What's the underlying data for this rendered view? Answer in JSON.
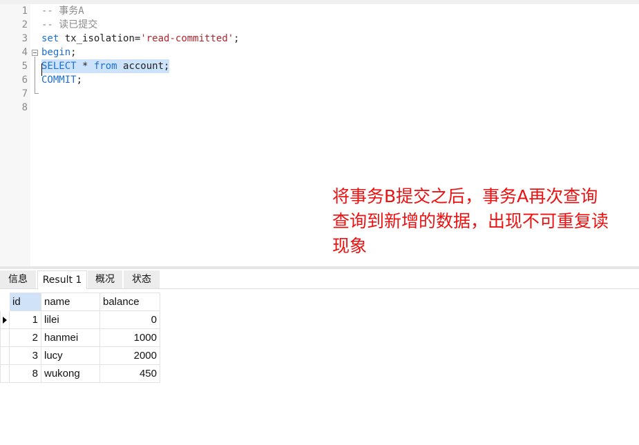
{
  "editor": {
    "line_numbers": [
      "1",
      "2",
      "3",
      "4",
      "5",
      "6",
      "7",
      "8"
    ],
    "lines": {
      "l1": {
        "comment": "-- 事务A"
      },
      "l2": {
        "comment": "-- 读已提交"
      },
      "l3": {
        "kw": "set",
        "plain": " tx_isolation=",
        "str": "'read-committed'",
        "end": ";"
      },
      "l4": {
        "kw": "begin",
        "end": ";"
      },
      "l5": {
        "kw1": "SELECT",
        "op": " * ",
        "kw2": "from",
        "plain": " account;"
      },
      "l6": {
        "kw": "COMMIT",
        "end": ";"
      }
    }
  },
  "annotation": {
    "line1": "将事务B提交之后，事务A再次查询",
    "line2": "查询到新增的数据，出现不可重复读",
    "line3": "现象"
  },
  "result_tabs": [
    {
      "label": "信息"
    },
    {
      "label": "Result 1"
    },
    {
      "label": "概况"
    },
    {
      "label": "状态"
    }
  ],
  "active_tab": "Result 1",
  "result_grid": {
    "columns": [
      "id",
      "name",
      "balance"
    ],
    "rows": [
      [
        "1",
        "lilei",
        "0"
      ],
      [
        "2",
        "hanmei",
        "1000"
      ],
      [
        "3",
        "lucy",
        "2000"
      ],
      [
        "8",
        "wukong",
        "450"
      ]
    ]
  },
  "colors": {
    "keyword": "#1b6fd6",
    "string": "#b0262f",
    "comment": "#8a8a8a",
    "selection": "#cde3fb",
    "annotation": "#ee1111"
  }
}
